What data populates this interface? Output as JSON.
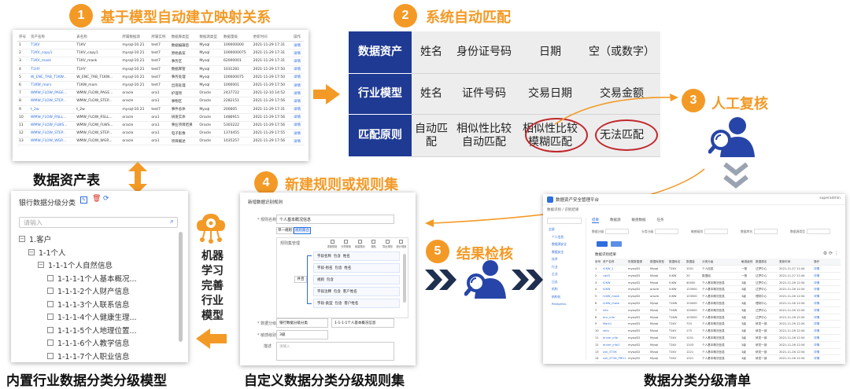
{
  "steps": [
    {
      "num": "1",
      "label": "基于模型自动建立映射关系"
    },
    {
      "num": "2",
      "label": "系统自动匹配"
    },
    {
      "num": "3",
      "label": "人工复核"
    },
    {
      "num": "4",
      "label": "新建规则或规则集"
    },
    {
      "num": "5",
      "label": "结果检核"
    }
  ],
  "captions": {
    "asset_table": "数据资产表",
    "builtin_model": "内置行业数据分类分级模型",
    "custom_rules": "自定义数据分类分级规则集",
    "result_list": "数据分类分级清单"
  },
  "ml_text": [
    "机器",
    "学习",
    "完善",
    "行业",
    "模型"
  ],
  "match_grid": {
    "rows": [
      {
        "header": "数据资产",
        "cells": [
          "姓名",
          "身份证号码",
          "日期",
          "空（或数字）"
        ]
      },
      {
        "header": "行业模型",
        "cells": [
          "姓名",
          "证件号码",
          "交易日期",
          "交易金额"
        ]
      },
      {
        "header": "匹配原则",
        "cells": [
          "自动匹配",
          "相似性比较\n自动匹配",
          "相似性比较\n模糊匹配",
          "无法匹配"
        ]
      }
    ]
  },
  "asset_table": {
    "headers": [
      "序号",
      "资产名称",
      "表名称",
      "所属数据源",
      "所属实例",
      "数据库类型",
      "数据源类型",
      "数据量级",
      "更新时间",
      "操作"
    ],
    "rows": [
      [
        "1",
        "T1KV",
        "T1KV",
        "mysql-10.21",
        "test7",
        "数据编辑后",
        "Mysql",
        "100000000",
        "2021-11-29 17:31",
        "详情"
      ],
      [
        "2",
        "T1KV_copy1",
        "T1KV_copy1",
        "mysql-10.21",
        "test7",
        "原始备案",
        "Mysql",
        "1000000075",
        "2021-11-29 17:31",
        "详情"
      ],
      [
        "3",
        "T1KV_mask",
        "T1KV_mask",
        "mysql-10.21",
        "test7",
        "事务区",
        "Mysql",
        "62000001",
        "2021-11-29 17:31",
        "详情"
      ],
      [
        "4",
        "T1HY",
        "T1HY",
        "mysql-10.21",
        "test7",
        "数据库管",
        "Mysql",
        "1031281",
        "2021-11-29 17:50",
        "详情"
      ],
      [
        "5",
        "W_ENC_TAB_T1KW...",
        "W_ENC_TAB_T1KW...",
        "mysql-10.21",
        "test7",
        "事务处理",
        "Mysql",
        "100000075",
        "2021-11-29 17:50",
        "详情"
      ],
      [
        "6",
        "T1KW_mars",
        "T1KW_mars",
        "mysql-10.21",
        "test7",
        "出现处理",
        "Mysql",
        "1000001",
        "2021-11-29 17:50",
        "详情"
      ],
      [
        "7",
        "WMW_FLOW_PAGE...",
        "WMW_FLOW_PAGE...",
        "oracle",
        "ora1",
        "护理项",
        "Oracle",
        "2437722",
        "2021-12-10 14:52",
        "详情"
      ],
      [
        "8",
        "WMW_FLOW_STEP...",
        "WMW_FLOW_STEP...",
        "oracle",
        "ora1",
        "事物区",
        "Oracle",
        "2282151",
        "2021-11-29 17:56",
        "详情"
      ],
      [
        "9",
        "t_2w",
        "t_2w",
        "mysql-10.21",
        "test7",
        "事件总体",
        "Mysql",
        "200005",
        "2021-11-29 17:31",
        "详情"
      ],
      [
        "10",
        "WMW_FLOW_RSLL...",
        "WMW_FLOW_RSLL...",
        "oracle",
        "ora1",
        "研发实体",
        "Oracle",
        "1486915",
        "2021-11-29 17:56",
        "详情"
      ],
      [
        "11",
        "WMW_FLOW_FLWS...",
        "WMW_FLOW_FLWS...",
        "oracle",
        "ora1",
        "事业项目结果",
        "Oracle",
        "5303222",
        "2021-11-29 17:56",
        "详情"
      ],
      [
        "12",
        "WMW_FLOW_STEP...",
        "WMW_FLOW_STEP...",
        "oracle",
        "ora1",
        "电子影像",
        "Oracle",
        "1374455",
        "2021-11-29 17:55",
        "详情"
      ],
      [
        "13",
        "WMW_FLOW_WGR...",
        "WMW_FLOW_WGR...",
        "oracle",
        "ora1",
        "项目概述",
        "Oracle",
        "1035257",
        "2021-11-29 17:56",
        "详情"
      ]
    ]
  },
  "tree_panel": {
    "title": "银行数据分级分类",
    "search_placeholder": "请输入",
    "items": [
      "1.客户",
      "1-1个人",
      "1-1-1个人自然信息",
      "1-1-1-1个人基本概况...",
      "1-1-1-2个人财产信息",
      "1-1-1-3个人联系信息",
      "1-1-1-4个人健康生理...",
      "1-1-1-5个人地理位置...",
      "1-1-1-6个人教学信息",
      "1-1-1-7个人职业信息"
    ]
  },
  "rule_panel": {
    "title": "新增数据识别规则",
    "rule_name_label": "* 规则名称",
    "rule_name_value": "个人基本概况信息",
    "tabs": [
      "单一规则",
      "规则集合"
    ],
    "config_label": "规则集管理",
    "toolbar": [
      "重置规则",
      "分项规则",
      "增量规则",
      "随机",
      "导出规则",
      "统计规则"
    ],
    "conditions": [
      "字段名称  包含  姓名",
      "字段-别名  包含  姓名",
      "规则  包含",
      "字段注释  包含  客户姓名",
      "字段-类型  包含  客户姓名"
    ],
    "connector": "并且",
    "level_label": "* 数据分级",
    "level_value": "银行数据分级分类",
    "level_value2": "1-1-1-1个人基本概况信息",
    "sens_label": "* 敏感级别",
    "sens_value": "3级",
    "desc_label": "描述",
    "desc_placeholder": "请输入"
  },
  "result_panel": {
    "title": "数据资产安全管理平台",
    "user": "superadmin",
    "breadcrumb": "数据识别 / 识别结果",
    "sidebar": [
      "全部",
      "个人信息",
      "数据源安全",
      "数据安全",
      "技术",
      "行业",
      "企业",
      "日志",
      "机构",
      "结构化",
      "Restgress"
    ],
    "tabs": [
      "结果",
      "数据源",
      "敏感数据",
      "任务"
    ],
    "filter_labels": [
      "数据分级",
      "分类分级",
      "敏感级别",
      "数据库名",
      "数据源类型"
    ],
    "table_title": "数据识别结果",
    "headers": [
      "序号",
      "资产名称",
      "所属数据源",
      "数据库类型",
      "数据库名",
      "数据量",
      "分类分级",
      "敏感级别",
      "数据源名",
      "更新时间",
      "操作"
    ],
    "rows": [
      [
        "1",
        "t1KW_1",
        "mysql32",
        "Mysql",
        "T1KV",
        "1001",
        "个人信息",
        "一般",
        "达梦中心",
        "2021-11-27 11:44",
        "详情"
      ],
      [
        "2",
        "cdd3",
        "mysql32",
        "Mysql",
        "t1KW",
        "20",
        "数据组",
        "一般",
        "达梦中心",
        "2021-11-27 11:44",
        "详情"
      ],
      [
        "3",
        "t2KW",
        "mysql32",
        "Mysql",
        "t1KW",
        "40000",
        "个人基本概况信息",
        "3级",
        "达梦中心",
        "2021-11-26 12:34",
        "详情"
      ],
      [
        "4",
        "t2KW",
        "mysql32",
        "oracle",
        "t1KW",
        "120000",
        "个人基本概况信息",
        "3级",
        "达梦中心",
        "2021-11-26 12:34",
        "详情"
      ],
      [
        "5",
        "t1KW_mask",
        "mysql32",
        "oracle",
        "t1KW",
        "103500",
        "个人基本概况信息",
        "3级",
        "理财中心",
        "2021-11-26 12:34",
        "详情"
      ],
      [
        "6",
        "t1KW_mask",
        "mysql32",
        "Mysql",
        "T1KW",
        "120000",
        "个人基本概况信息",
        "3级",
        "理财中心",
        "2021-11-26 12:34",
        "详情"
      ],
      [
        "7",
        "info",
        "mysql32",
        "Mysql",
        "T1KW",
        "100000",
        "个人基本概况信息",
        "3级",
        "达梦中心",
        "2021-11-26 12:34",
        "详情"
      ],
      [
        "8",
        "enc_info",
        "mysql32",
        "Mysql",
        "T1KW",
        "103500",
        "个人基本概况信息",
        "3级",
        "达梦中心",
        "2021-11-26 12:34",
        "详情"
      ],
      [
        "9",
        "Mark1",
        "mysql32",
        "Mysql",
        "T1KV",
        "720",
        "个人基本概况信息",
        "3级",
        "研发一部",
        "2021-11-26 12:34",
        "详情"
      ],
      [
        "10",
        "stdu",
        "mysql32",
        "Mysql",
        "T1KV",
        "175",
        "个人基本概况信息",
        "3级",
        "研发一部",
        "2021-11-26 12:34",
        "详情"
      ],
      [
        "11",
        "driver_info",
        "mysql32",
        "Mysql",
        "T1KV",
        "1201",
        "个人基本概况信息",
        "3级",
        "研发一部",
        "2021-11-26 12:34",
        "详情"
      ],
      [
        "12",
        "driver_info2",
        "mysql32",
        "Mysql",
        "T1KV",
        "1203",
        "个人基本概况信息",
        "3级",
        "研发一部",
        "2021-11-26 12:34",
        "详情"
      ],
      [
        "13",
        "xxk_STOK",
        "mysql32",
        "Mysql",
        "T1KV",
        "1221",
        "个人基本概况信息",
        "3级",
        "研发一部",
        "2021-11-26 12:34",
        "详情"
      ],
      [
        "14",
        "xxk_STOK_PRO1",
        "mysql32",
        "Mysql",
        "T1KV",
        "1321",
        "个人基本概况信息",
        "3级",
        "研发一部",
        "2021-11-26 12:34",
        "详情"
      ]
    ]
  },
  "colors": {
    "accent": "#f39a26",
    "navy": "#1f3a93",
    "grid_bg": "#ededed",
    "icon_blue": "#2745a8",
    "chevron_gray": "#9aa3b1"
  }
}
